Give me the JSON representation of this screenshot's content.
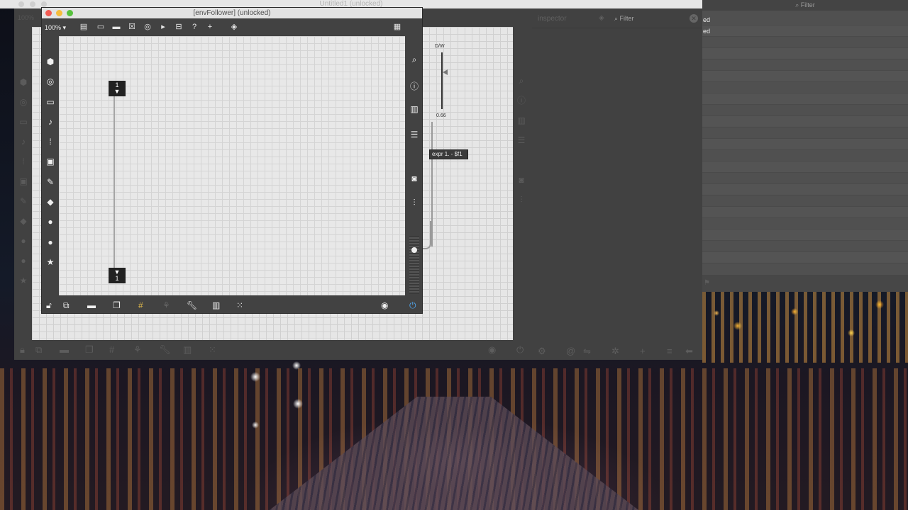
{
  "background_app": {
    "title": "Untitled1 (unlocked)",
    "zoom": "100%",
    "dw_label": "D/W",
    "dw_value": "0.66",
    "expr_text": "expr 1. - $f1"
  },
  "inspector": {
    "title": "inspector",
    "filter_label": "Filter"
  },
  "right_panel": {
    "filter_label": "Filter",
    "rows": [
      "ed",
      "ed"
    ]
  },
  "env_window": {
    "title": "[envFollower] (unlocked)",
    "zoom": "100% ▾",
    "inlet_number": "1",
    "outlet_number": "1"
  },
  "colors": {
    "close": "#f25b52",
    "minimize": "#f6bd3c",
    "maximize": "#56c13d",
    "power_accent": "#4fa3e8"
  }
}
